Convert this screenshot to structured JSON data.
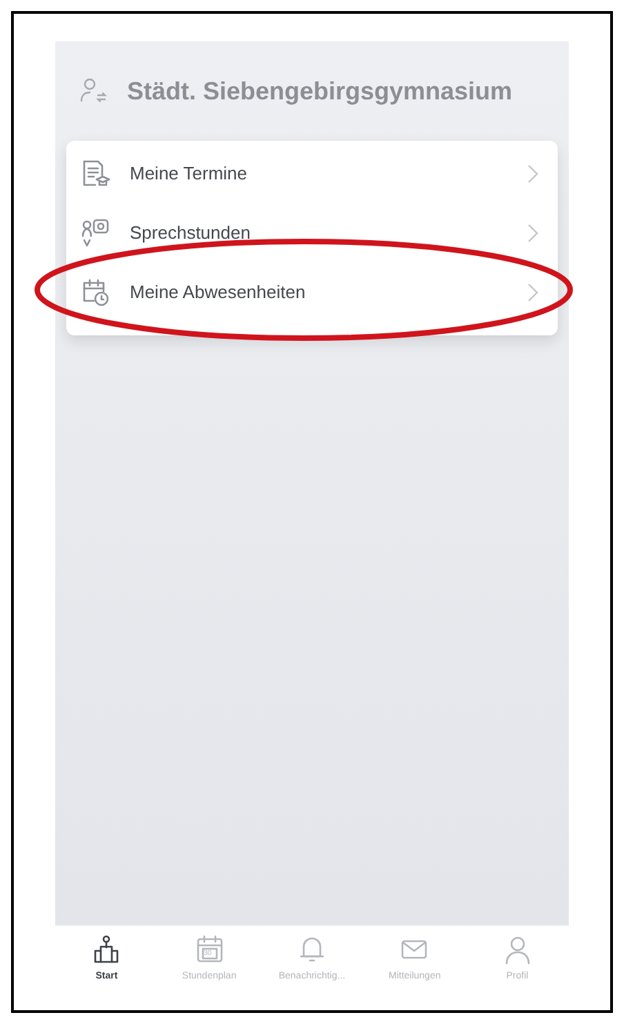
{
  "header": {
    "title": "Städt. Siebengebirgsgymnasium"
  },
  "menu": [
    {
      "label": "Meine Termine",
      "kind": "appointments",
      "highlighted": false
    },
    {
      "label": "Sprechstunden",
      "kind": "consultation",
      "highlighted": false
    },
    {
      "label": "Meine Abwesenheiten",
      "kind": "absence",
      "highlighted": true
    }
  ],
  "tab_bar": [
    {
      "label": "Start",
      "kind": "home",
      "selected": true
    },
    {
      "label": "Stundenplan",
      "kind": "calendar",
      "icon_text": "30",
      "selected": false
    },
    {
      "label": "Benachrichtig...",
      "kind": "bell",
      "selected": false
    },
    {
      "label": "Mitteilungen",
      "kind": "mail",
      "selected": false
    },
    {
      "label": "Profil",
      "kind": "person",
      "selected": false
    }
  ]
}
